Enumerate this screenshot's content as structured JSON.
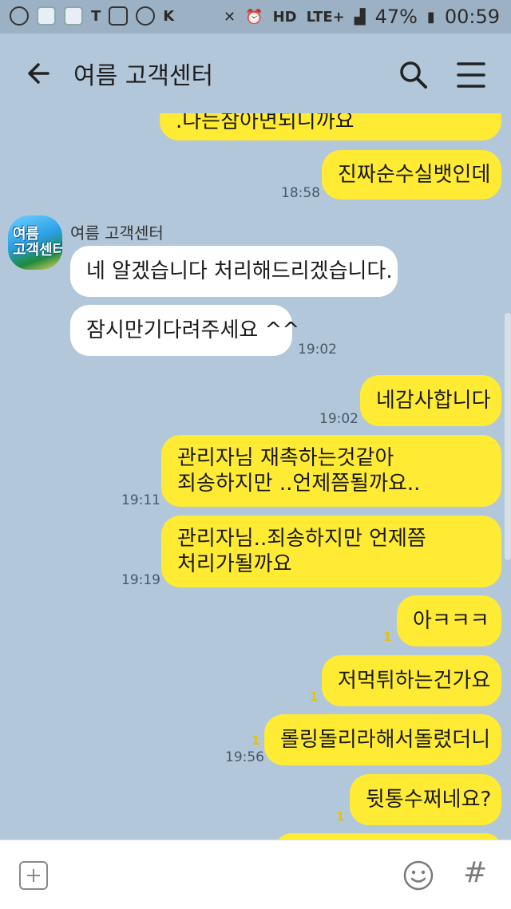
{
  "status_bar": {
    "battery": "47%",
    "time": "00:59",
    "network": "LTE+"
  },
  "header": {
    "title": "여름 고객센터"
  },
  "chat": {
    "sender_name": "여름 고객센터",
    "avatar_text": "여름\n고객센터",
    "messages": [
      {
        "from": "me",
        "text": ".나는참아면되니까요"
      },
      {
        "from": "me",
        "text": "진짜순수실뱃인데",
        "time": "18:58"
      },
      {
        "from": "other",
        "text": "네 알겠습니다 처리해드리겠습니다."
      },
      {
        "from": "other",
        "text": "잠시만기다려주세요 ^^",
        "time": "19:02"
      },
      {
        "from": "me",
        "text": "네감사합니다",
        "time": "19:02"
      },
      {
        "from": "me",
        "text": "관리자님 재촉하는것같아\n죄송하지만 ..언제쯤될까요..",
        "time": "19:11"
      },
      {
        "from": "me",
        "text": "관리자님..죄송하지만 언제쯤\n처리가될까요",
        "time": "19:19"
      },
      {
        "from": "me",
        "text": "아ㅋㅋㅋ",
        "unread": "1"
      },
      {
        "from": "me",
        "text": "저먹튀하는건가요",
        "unread": "1"
      },
      {
        "from": "me",
        "text": "롤링돌리라해서돌렸더니",
        "unread": "1",
        "time": "19:56"
      },
      {
        "from": "me",
        "text": "뒷통수쩌네요?",
        "unread": "1"
      }
    ]
  },
  "colors": {
    "background": "#b2c7da",
    "my_bubble": "#ffeb33",
    "other_bubble": "#ffffff"
  }
}
